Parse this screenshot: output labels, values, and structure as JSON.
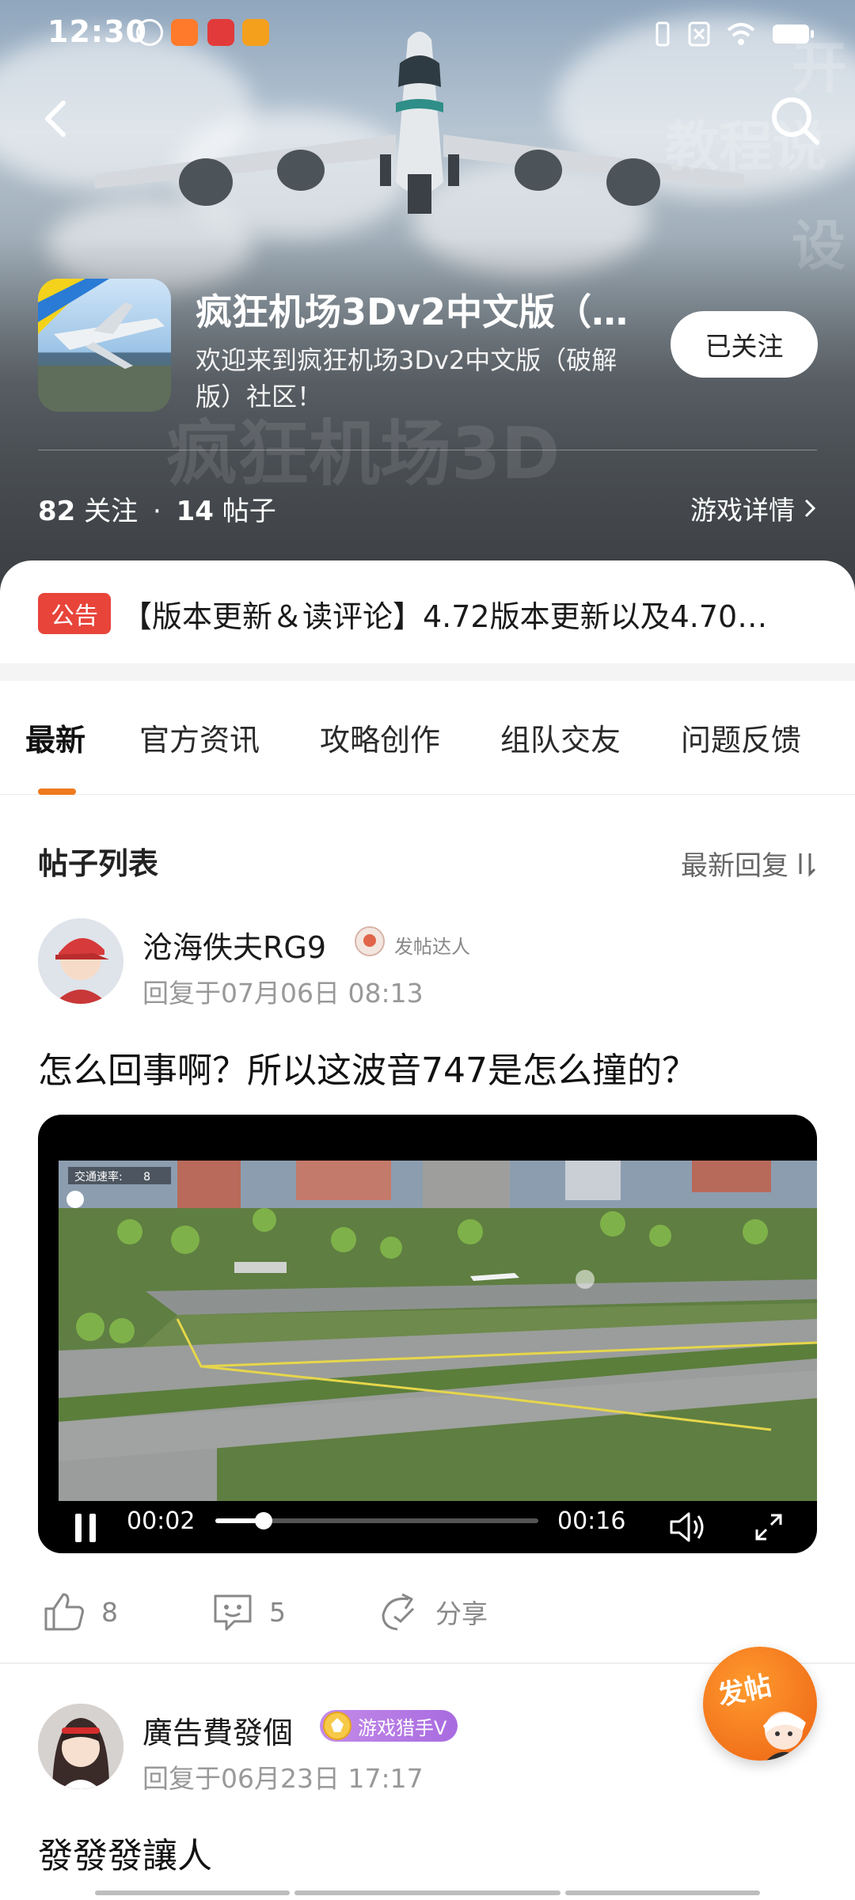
{
  "status_bar": {
    "time": "12:30",
    "icons": [
      "k-icon",
      "app-icon-orange",
      "app-icon-red",
      "app-icon-video"
    ],
    "right_icons": [
      "vibrate-icon",
      "no-sim-icon",
      "wifi-icon",
      "battery-icon"
    ]
  },
  "header": {
    "game_title": "疯狂机场3Dv2中文版（…",
    "game_description": "欢迎来到疯狂机场3Dv2中文版（破解版）社区！",
    "follow_label": "已关注",
    "followers_count": "82",
    "followers_label": "关注",
    "posts_count": "14",
    "posts_label": "帖子",
    "separator": "·",
    "game_detail_label": "游戏详情"
  },
  "notice": {
    "tag": "公告",
    "text": "【版本更新＆读评论】4.72版本更新以及4.70…"
  },
  "tabs": [
    {
      "label": "最新",
      "active": true
    },
    {
      "label": "官方资讯",
      "active": false
    },
    {
      "label": "攻略创作",
      "active": false
    },
    {
      "label": "组队交友",
      "active": false
    },
    {
      "label": "问题反馈",
      "active": false
    }
  ],
  "post_list": {
    "title": "帖子列表",
    "sort_label": "最新回复"
  },
  "posts": [
    {
      "author": "沧海佚夫RG9",
      "badge": "发帖达人",
      "time": "回复于07月06日 08:13",
      "text": "怎么回事啊？所以这波音747是怎么撞的？",
      "video": {
        "current_time": "00:02",
        "duration": "00:16",
        "progress": 0.15,
        "overlay_label": "交通速率:",
        "overlay_value": "8"
      },
      "likes": "8",
      "comments": "5",
      "share_label": "分享"
    },
    {
      "author": "廣告費發個",
      "badge": "游戏猎手V",
      "time": "回复于06月23日 17:17",
      "text": "發發發讓人"
    }
  ],
  "fab_label": "发帖",
  "colors": {
    "accent": "#f07a1c",
    "notice_tag": "#e8443a",
    "badge_purple": "#a86be0"
  }
}
